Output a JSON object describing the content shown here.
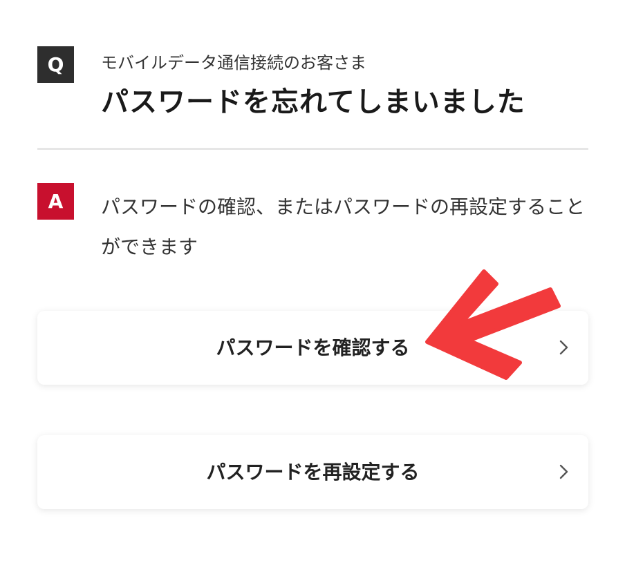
{
  "question": {
    "badge": "Q",
    "subtitle": "モバイルデータ通信接続のお客さま",
    "title": "パスワードを忘れてしまいました"
  },
  "answer": {
    "badge": "A",
    "text": "パスワードの確認、またはパスワードの再設定することができます"
  },
  "actions": [
    {
      "label": "パスワードを確認する",
      "icon": "chevron-right-icon"
    },
    {
      "label": "パスワードを再設定する",
      "icon": "chevron-right-icon"
    }
  ],
  "annotation": {
    "icon": "red-arrow-icon",
    "color": "#f23a3c"
  },
  "colors": {
    "q_badge": "#2e2e2e",
    "a_badge": "#c8102e",
    "divider": "#e6e6e6"
  }
}
